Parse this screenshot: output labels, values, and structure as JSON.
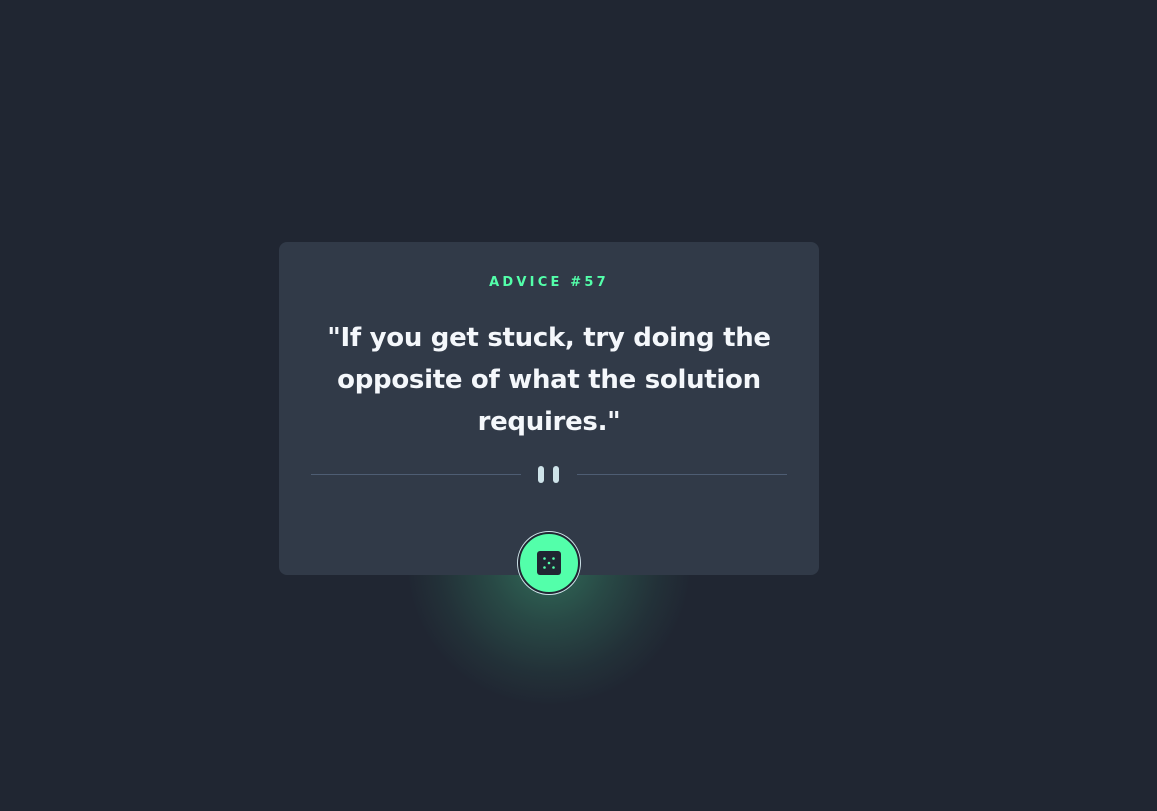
{
  "advice": {
    "heading": "ADVICE #57",
    "quote": "\"If you get stuck, try doing the opposite of what the solution requires.\""
  },
  "button": {
    "aria_label": "Generate new advice",
    "icon": "dice-icon"
  },
  "colors": {
    "background": "#202632",
    "card": "#313a48",
    "accent": "#53ffaa",
    "text": "#f4f7fb",
    "divider": "#4e5d73",
    "pause": "#cee3e9"
  }
}
